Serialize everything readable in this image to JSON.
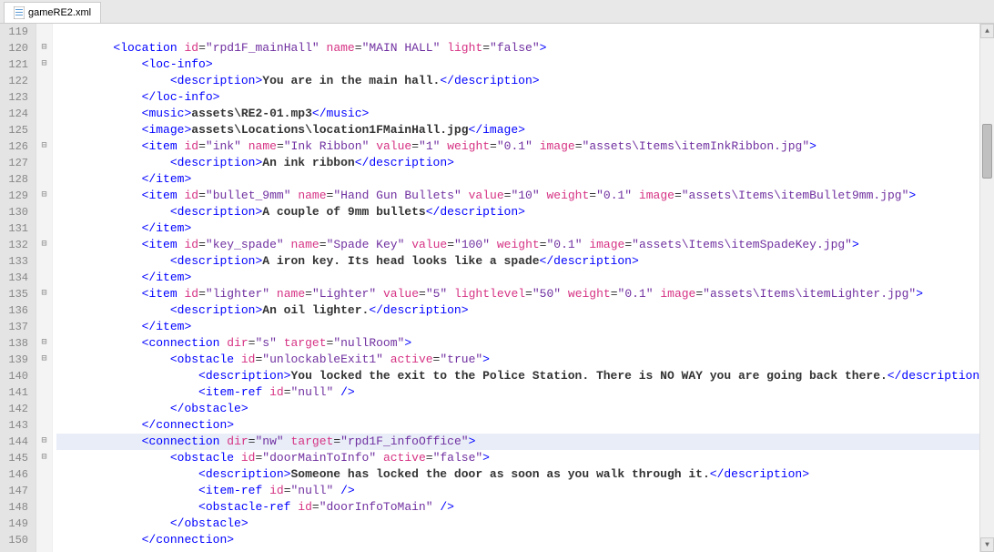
{
  "tab": {
    "filename": "gameRE2.xml"
  },
  "startLine": 119,
  "highlightedLine": 144,
  "fold": {
    "120": "minus",
    "121": "minus",
    "126": "minus",
    "129": "minus",
    "132": "minus",
    "135": "minus",
    "138": "minus",
    "139": "minus",
    "144": "minus",
    "145": "minus"
  },
  "code": [
    {
      "i": 8,
      "tokens": []
    },
    {
      "i": 8,
      "tokens": [
        [
          "b",
          "<"
        ],
        [
          "tag",
          "location"
        ],
        [
          "sp",
          " "
        ],
        [
          "a",
          "id"
        ],
        [
          "eq",
          "="
        ],
        [
          "s",
          "\"rpd1F_mainHall\""
        ],
        [
          "sp",
          " "
        ],
        [
          "a",
          "name"
        ],
        [
          "eq",
          "="
        ],
        [
          "s",
          "\"MAIN HALL\""
        ],
        [
          "sp",
          " "
        ],
        [
          "a",
          "light"
        ],
        [
          "eq",
          "="
        ],
        [
          "s",
          "\"false\""
        ],
        [
          "b",
          ">"
        ]
      ]
    },
    {
      "i": 12,
      "tokens": [
        [
          "b",
          "<"
        ],
        [
          "tag",
          "loc-info"
        ],
        [
          "b",
          ">"
        ]
      ]
    },
    {
      "i": 16,
      "tokens": [
        [
          "b",
          "<"
        ],
        [
          "tag",
          "description"
        ],
        [
          "b",
          ">"
        ],
        [
          "t",
          "You are in the main hall."
        ],
        [
          "b",
          "</"
        ],
        [
          "tag",
          "description"
        ],
        [
          "b",
          ">"
        ]
      ]
    },
    {
      "i": 12,
      "tokens": [
        [
          "b",
          "</"
        ],
        [
          "tag",
          "loc-info"
        ],
        [
          "b",
          ">"
        ]
      ]
    },
    {
      "i": 12,
      "tokens": [
        [
          "b",
          "<"
        ],
        [
          "tag",
          "music"
        ],
        [
          "b",
          ">"
        ],
        [
          "t",
          "assets\\RE2-01.mp3"
        ],
        [
          "b",
          "</"
        ],
        [
          "tag",
          "music"
        ],
        [
          "b",
          ">"
        ]
      ]
    },
    {
      "i": 12,
      "tokens": [
        [
          "b",
          "<"
        ],
        [
          "tag",
          "image"
        ],
        [
          "b",
          ">"
        ],
        [
          "t",
          "assets\\Locations\\location1FMainHall.jpg"
        ],
        [
          "b",
          "</"
        ],
        [
          "tag",
          "image"
        ],
        [
          "b",
          ">"
        ]
      ]
    },
    {
      "i": 12,
      "tokens": [
        [
          "b",
          "<"
        ],
        [
          "tag",
          "item"
        ],
        [
          "sp",
          " "
        ],
        [
          "a",
          "id"
        ],
        [
          "eq",
          "="
        ],
        [
          "s",
          "\"ink\""
        ],
        [
          "sp",
          " "
        ],
        [
          "a",
          "name"
        ],
        [
          "eq",
          "="
        ],
        [
          "s",
          "\"Ink Ribbon\""
        ],
        [
          "sp",
          " "
        ],
        [
          "a",
          "value"
        ],
        [
          "eq",
          "="
        ],
        [
          "s",
          "\"1\""
        ],
        [
          "sp",
          " "
        ],
        [
          "a",
          "weight"
        ],
        [
          "eq",
          "="
        ],
        [
          "s",
          "\"0.1\""
        ],
        [
          "sp",
          " "
        ],
        [
          "a",
          "image"
        ],
        [
          "eq",
          "="
        ],
        [
          "s",
          "\"assets\\Items\\itemInkRibbon.jpg\""
        ],
        [
          "b",
          ">"
        ]
      ]
    },
    {
      "i": 16,
      "tokens": [
        [
          "b",
          "<"
        ],
        [
          "tag",
          "description"
        ],
        [
          "b",
          ">"
        ],
        [
          "t",
          "An ink ribbon"
        ],
        [
          "b",
          "</"
        ],
        [
          "tag",
          "description"
        ],
        [
          "b",
          ">"
        ]
      ]
    },
    {
      "i": 12,
      "tokens": [
        [
          "b",
          "</"
        ],
        [
          "tag",
          "item"
        ],
        [
          "b",
          ">"
        ]
      ]
    },
    {
      "i": 12,
      "tokens": [
        [
          "b",
          "<"
        ],
        [
          "tag",
          "item"
        ],
        [
          "sp",
          " "
        ],
        [
          "a",
          "id"
        ],
        [
          "eq",
          "="
        ],
        [
          "s",
          "\"bullet_9mm\""
        ],
        [
          "sp",
          " "
        ],
        [
          "a",
          "name"
        ],
        [
          "eq",
          "="
        ],
        [
          "s",
          "\"Hand Gun Bullets\""
        ],
        [
          "sp",
          " "
        ],
        [
          "a",
          "value"
        ],
        [
          "eq",
          "="
        ],
        [
          "s",
          "\"10\""
        ],
        [
          "sp",
          " "
        ],
        [
          "a",
          "weight"
        ],
        [
          "eq",
          "="
        ],
        [
          "s",
          "\"0.1\""
        ],
        [
          "sp",
          " "
        ],
        [
          "a",
          "image"
        ],
        [
          "eq",
          "="
        ],
        [
          "s",
          "\"assets\\Items\\itemBullet9mm.jpg\""
        ],
        [
          "b",
          ">"
        ]
      ]
    },
    {
      "i": 16,
      "tokens": [
        [
          "b",
          "<"
        ],
        [
          "tag",
          "description"
        ],
        [
          "b",
          ">"
        ],
        [
          "t",
          "A couple of 9mm bullets"
        ],
        [
          "b",
          "</"
        ],
        [
          "tag",
          "description"
        ],
        [
          "b",
          ">"
        ]
      ]
    },
    {
      "i": 12,
      "tokens": [
        [
          "b",
          "</"
        ],
        [
          "tag",
          "item"
        ],
        [
          "b",
          ">"
        ]
      ]
    },
    {
      "i": 12,
      "tokens": [
        [
          "b",
          "<"
        ],
        [
          "tag",
          "item"
        ],
        [
          "sp",
          " "
        ],
        [
          "a",
          "id"
        ],
        [
          "eq",
          "="
        ],
        [
          "s",
          "\"key_spade\""
        ],
        [
          "sp",
          " "
        ],
        [
          "a",
          "name"
        ],
        [
          "eq",
          "="
        ],
        [
          "s",
          "\"Spade Key\""
        ],
        [
          "sp",
          " "
        ],
        [
          "a",
          "value"
        ],
        [
          "eq",
          "="
        ],
        [
          "s",
          "\"100\""
        ],
        [
          "sp",
          " "
        ],
        [
          "a",
          "weight"
        ],
        [
          "eq",
          "="
        ],
        [
          "s",
          "\"0.1\""
        ],
        [
          "sp",
          " "
        ],
        [
          "a",
          "image"
        ],
        [
          "eq",
          "="
        ],
        [
          "s",
          "\"assets\\Items\\itemSpadeKey.jpg\""
        ],
        [
          "b",
          ">"
        ]
      ]
    },
    {
      "i": 16,
      "tokens": [
        [
          "b",
          "<"
        ],
        [
          "tag",
          "description"
        ],
        [
          "b",
          ">"
        ],
        [
          "t",
          "A iron key. Its head looks like a spade"
        ],
        [
          "b",
          "</"
        ],
        [
          "tag",
          "description"
        ],
        [
          "b",
          ">"
        ]
      ]
    },
    {
      "i": 12,
      "tokens": [
        [
          "b",
          "</"
        ],
        [
          "tag",
          "item"
        ],
        [
          "b",
          ">"
        ]
      ]
    },
    {
      "i": 12,
      "tokens": [
        [
          "b",
          "<"
        ],
        [
          "tag",
          "item"
        ],
        [
          "sp",
          " "
        ],
        [
          "a",
          "id"
        ],
        [
          "eq",
          "="
        ],
        [
          "s",
          "\"lighter\""
        ],
        [
          "sp",
          " "
        ],
        [
          "a",
          "name"
        ],
        [
          "eq",
          "="
        ],
        [
          "s",
          "\"Lighter\""
        ],
        [
          "sp",
          " "
        ],
        [
          "a",
          "value"
        ],
        [
          "eq",
          "="
        ],
        [
          "s",
          "\"5\""
        ],
        [
          "sp",
          " "
        ],
        [
          "a",
          "lightlevel"
        ],
        [
          "eq",
          "="
        ],
        [
          "s",
          "\"50\""
        ],
        [
          "sp",
          " "
        ],
        [
          "a",
          "weight"
        ],
        [
          "eq",
          "="
        ],
        [
          "s",
          "\"0.1\""
        ],
        [
          "sp",
          " "
        ],
        [
          "a",
          "image"
        ],
        [
          "eq",
          "="
        ],
        [
          "s",
          "\"assets\\Items\\itemLighter.jpg\""
        ],
        [
          "b",
          ">"
        ]
      ]
    },
    {
      "i": 16,
      "tokens": [
        [
          "b",
          "<"
        ],
        [
          "tag",
          "description"
        ],
        [
          "b",
          ">"
        ],
        [
          "t",
          "An oil lighter."
        ],
        [
          "b",
          "</"
        ],
        [
          "tag",
          "description"
        ],
        [
          "b",
          ">"
        ]
      ]
    },
    {
      "i": 12,
      "tokens": [
        [
          "b",
          "</"
        ],
        [
          "tag",
          "item"
        ],
        [
          "b",
          ">"
        ]
      ]
    },
    {
      "i": 12,
      "tokens": [
        [
          "b",
          "<"
        ],
        [
          "tag",
          "connection"
        ],
        [
          "sp",
          " "
        ],
        [
          "a",
          "dir"
        ],
        [
          "eq",
          "="
        ],
        [
          "s",
          "\"s\""
        ],
        [
          "sp",
          " "
        ],
        [
          "a",
          "target"
        ],
        [
          "eq",
          "="
        ],
        [
          "s",
          "\"nullRoom\""
        ],
        [
          "b",
          ">"
        ]
      ]
    },
    {
      "i": 16,
      "tokens": [
        [
          "b",
          "<"
        ],
        [
          "tag",
          "obstacle"
        ],
        [
          "sp",
          " "
        ],
        [
          "a",
          "id"
        ],
        [
          "eq",
          "="
        ],
        [
          "s",
          "\"unlockableExit1\""
        ],
        [
          "sp",
          " "
        ],
        [
          "a",
          "active"
        ],
        [
          "eq",
          "="
        ],
        [
          "s",
          "\"true\""
        ],
        [
          "b",
          ">"
        ]
      ]
    },
    {
      "i": 20,
      "tokens": [
        [
          "b",
          "<"
        ],
        [
          "tag",
          "description"
        ],
        [
          "b",
          ">"
        ],
        [
          "t",
          "You locked the exit to the Police Station. There is NO WAY you are going back there."
        ],
        [
          "b",
          "</"
        ],
        [
          "tag",
          "description"
        ],
        [
          "b",
          ">"
        ]
      ]
    },
    {
      "i": 20,
      "tokens": [
        [
          "b",
          "<"
        ],
        [
          "tag",
          "item-ref"
        ],
        [
          "sp",
          " "
        ],
        [
          "a",
          "id"
        ],
        [
          "eq",
          "="
        ],
        [
          "s",
          "\"null\""
        ],
        [
          "sp",
          " "
        ],
        [
          "b",
          "/>"
        ]
      ]
    },
    {
      "i": 16,
      "tokens": [
        [
          "b",
          "</"
        ],
        [
          "tag",
          "obstacle"
        ],
        [
          "b",
          ">"
        ]
      ]
    },
    {
      "i": 12,
      "tokens": [
        [
          "b",
          "</"
        ],
        [
          "tag",
          "connection"
        ],
        [
          "b",
          ">"
        ]
      ]
    },
    {
      "i": 12,
      "tokens": [
        [
          "b",
          "<"
        ],
        [
          "tag",
          "connection"
        ],
        [
          "sp",
          " "
        ],
        [
          "a",
          "dir"
        ],
        [
          "eq",
          "="
        ],
        [
          "s",
          "\"nw\""
        ],
        [
          "sp",
          " "
        ],
        [
          "a",
          "target"
        ],
        [
          "eq",
          "="
        ],
        [
          "s",
          "\"rpd1F_infoOffice\""
        ],
        [
          "b",
          ">"
        ]
      ]
    },
    {
      "i": 16,
      "tokens": [
        [
          "b",
          "<"
        ],
        [
          "tag",
          "obstacle"
        ],
        [
          "sp",
          " "
        ],
        [
          "a",
          "id"
        ],
        [
          "eq",
          "="
        ],
        [
          "s",
          "\"doorMainToInfo\""
        ],
        [
          "sp",
          " "
        ],
        [
          "a",
          "active"
        ],
        [
          "eq",
          "="
        ],
        [
          "s",
          "\"false\""
        ],
        [
          "b",
          ">"
        ]
      ]
    },
    {
      "i": 20,
      "tokens": [
        [
          "b",
          "<"
        ],
        [
          "tag",
          "description"
        ],
        [
          "b",
          ">"
        ],
        [
          "t",
          "Someone has locked the door as soon as you walk through it."
        ],
        [
          "b",
          "</"
        ],
        [
          "tag",
          "description"
        ],
        [
          "b",
          ">"
        ]
      ]
    },
    {
      "i": 20,
      "tokens": [
        [
          "b",
          "<"
        ],
        [
          "tag",
          "item-ref"
        ],
        [
          "sp",
          " "
        ],
        [
          "a",
          "id"
        ],
        [
          "eq",
          "="
        ],
        [
          "s",
          "\"null\""
        ],
        [
          "sp",
          " "
        ],
        [
          "b",
          "/>"
        ]
      ]
    },
    {
      "i": 20,
      "tokens": [
        [
          "b",
          "<"
        ],
        [
          "tag",
          "obstacle-ref"
        ],
        [
          "sp",
          " "
        ],
        [
          "a",
          "id"
        ],
        [
          "eq",
          "="
        ],
        [
          "s",
          "\"doorInfoToMain\""
        ],
        [
          "sp",
          " "
        ],
        [
          "b",
          "/>"
        ]
      ]
    },
    {
      "i": 16,
      "tokens": [
        [
          "b",
          "</"
        ],
        [
          "tag",
          "obstacle"
        ],
        [
          "b",
          ">"
        ]
      ]
    },
    {
      "i": 12,
      "tokens": [
        [
          "b",
          "</"
        ],
        [
          "tag",
          "connection"
        ],
        [
          "b",
          ">"
        ]
      ]
    }
  ]
}
